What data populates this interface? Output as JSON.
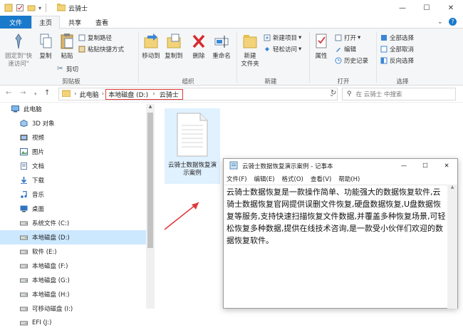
{
  "window": {
    "title": "云骑士",
    "quick_access": [
      "save-icon",
      "properties-icon",
      "folder-icon",
      "dropdown-icon"
    ],
    "controls": [
      "minimize",
      "maximize",
      "close"
    ],
    "minimize_glyph": "—",
    "maximize_glyph": "☐",
    "close_glyph": "✕"
  },
  "tabs": [
    {
      "label": "文件"
    },
    {
      "label": "主页"
    },
    {
      "label": "共享"
    },
    {
      "label": "查看"
    }
  ],
  "ribbon": {
    "clipboard": {
      "pin_label": "固定到\"快\n速访问\"",
      "copy_label": "复制",
      "paste_label": "粘贴",
      "copy_path_label": "复制路径",
      "paste_shortcut_label": "粘贴快捷方式",
      "cut_label": "剪切",
      "group_label": "剪贴板"
    },
    "organize": {
      "move_to_label": "移动到",
      "copy_to_label": "复制到",
      "delete_label": "删除",
      "rename_label": "重命名",
      "group_label": "组织"
    },
    "new": {
      "new_folder_label": "新建\n文件夹",
      "new_item_label": "新建项目",
      "easy_access_label": "轻松访问",
      "group_label": "新建"
    },
    "open": {
      "properties_label": "属性",
      "open_label": "打开",
      "edit_label": "编辑",
      "history_label": "历史记录",
      "group_label": "打开"
    },
    "select": {
      "select_all_label": "全部选择",
      "select_none_label": "全部取消",
      "invert_label": "反向选择",
      "group_label": "选择"
    }
  },
  "address": {
    "crumbs": [
      "此电脑",
      "本地磁盘 (D:)",
      "云骑士"
    ],
    "search_placeholder": "在 云骑士 中搜索"
  },
  "nav_pane": {
    "items": [
      {
        "label": "此电脑",
        "icon": "computer-icon",
        "indent": 0
      },
      {
        "label": "3D 对象",
        "icon": "cube-icon",
        "indent": 1
      },
      {
        "label": "视频",
        "icon": "video-icon",
        "indent": 1
      },
      {
        "label": "图片",
        "icon": "picture-icon",
        "indent": 1
      },
      {
        "label": "文档",
        "icon": "document-icon",
        "indent": 1
      },
      {
        "label": "下载",
        "icon": "download-icon",
        "indent": 1
      },
      {
        "label": "音乐",
        "icon": "music-icon",
        "indent": 1
      },
      {
        "label": "桌面",
        "icon": "desktop-icon",
        "indent": 1
      },
      {
        "label": "系统文件 (C:)",
        "icon": "drive-icon",
        "indent": 1
      },
      {
        "label": "本地磁盘 (D:)",
        "icon": "drive-icon",
        "indent": 1,
        "selected": true
      },
      {
        "label": "软件 (E:)",
        "icon": "drive-icon",
        "indent": 1
      },
      {
        "label": "本地磁盘 (F:)",
        "icon": "drive-icon",
        "indent": 1
      },
      {
        "label": "本地磁盘 (G:)",
        "icon": "drive-icon",
        "indent": 1
      },
      {
        "label": "本地磁盘 (H:)",
        "icon": "drive-icon",
        "indent": 1
      },
      {
        "label": "可移动磁盘 (I:)",
        "icon": "drive-icon",
        "indent": 1
      },
      {
        "label": "EFI (J:)",
        "icon": "drive-icon",
        "indent": 1
      }
    ]
  },
  "files": [
    {
      "name": "云骑士数据恢复演示案例",
      "icon": "text-file-icon"
    }
  ],
  "notepad": {
    "title": "云骑士数据恢复演示案例 - 记事本",
    "menu": [
      "文件(F)",
      "编辑(E)",
      "格式(O)",
      "查看(V)",
      "帮助(H)"
    ],
    "content": "云骑士数据恢复是一款操作简单、功能强大的数据恢复软件,云骑士数据恢复官网提供误删文件恢复,硬盘数据恢复,U盘数据恢复等服务,支持快速扫描恢复文件数据,并覆盖多种恢复场景,可轻松恢复多种数据,提供在线技术咨询,是一款受小伙伴们欢迎的数据恢复软件。"
  },
  "colors": {
    "file_tab": "#1979ca",
    "selection": "#cce8ff",
    "highlight_box": "#e03a3a",
    "arrow": "#e03a3a"
  }
}
